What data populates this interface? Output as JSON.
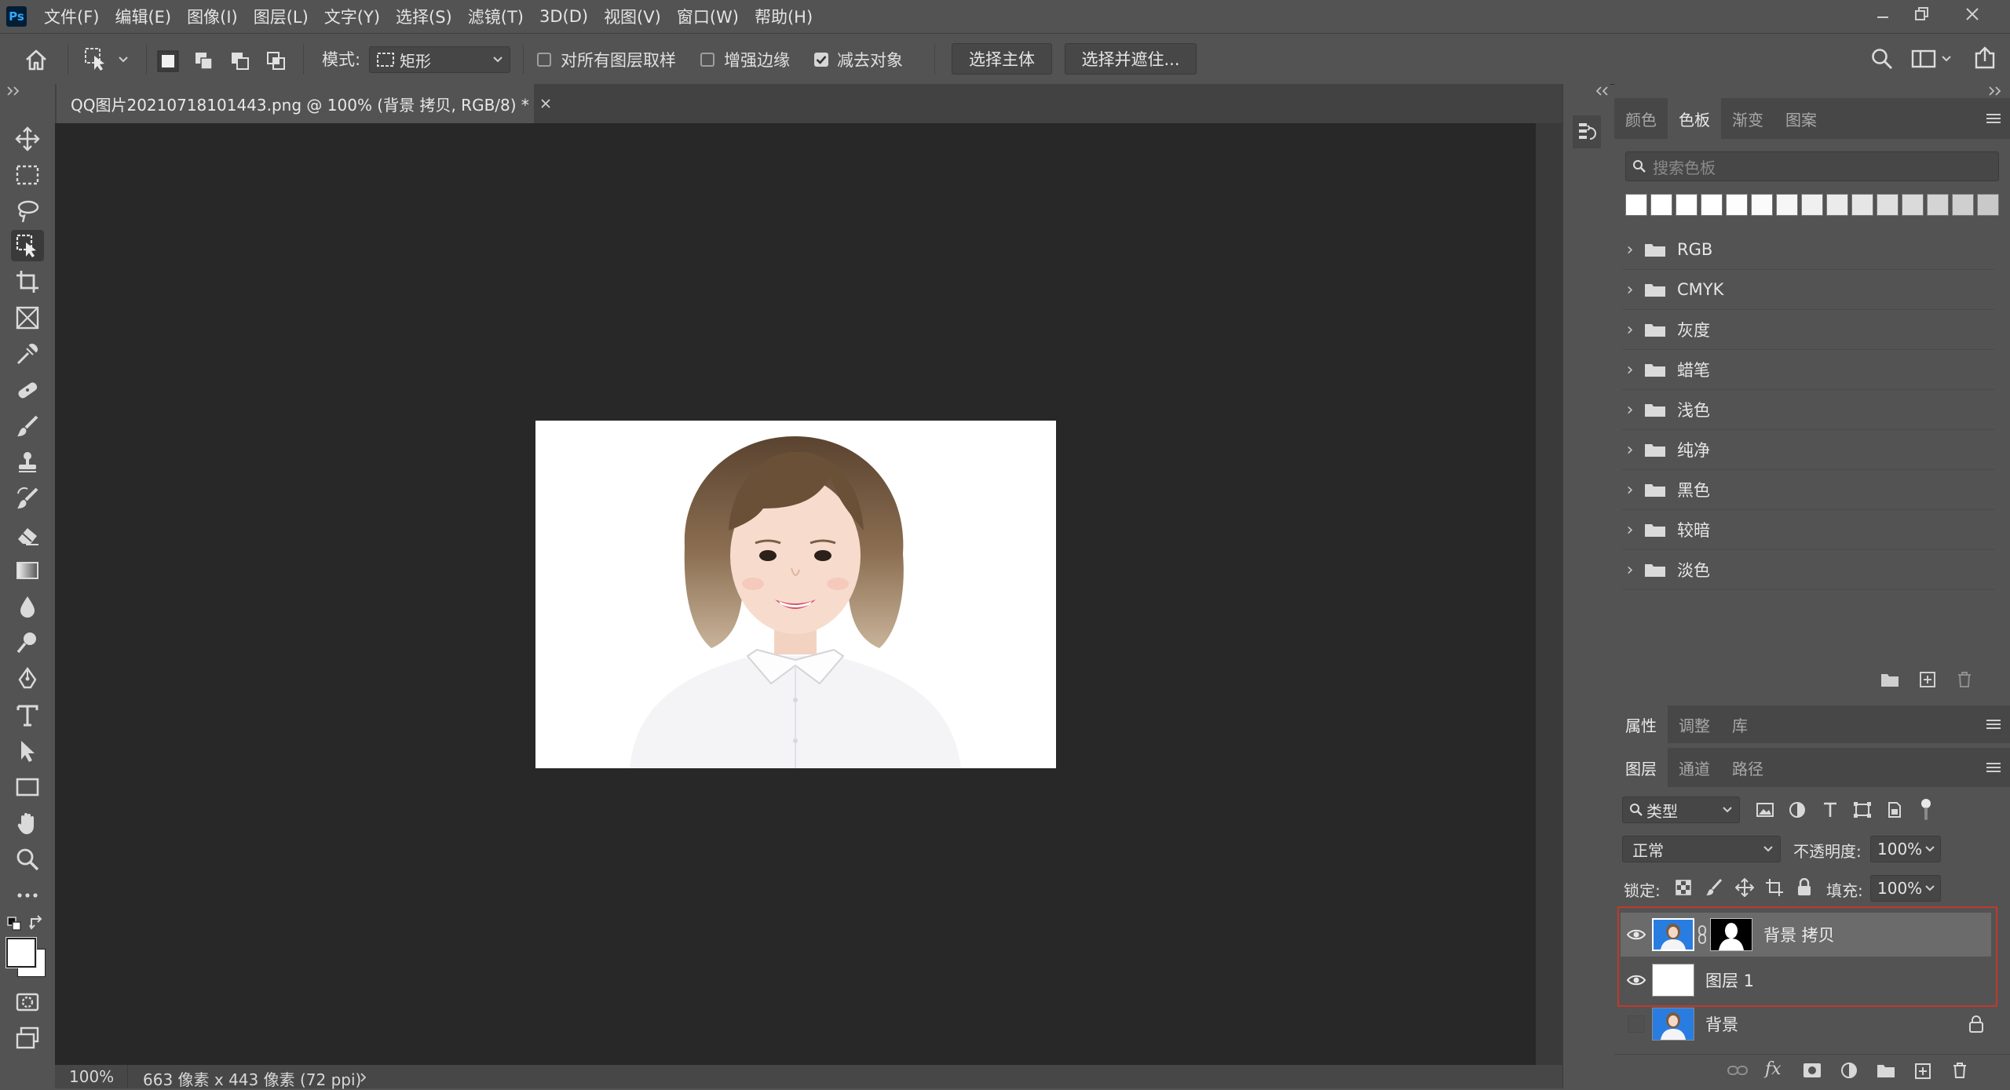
{
  "app": {
    "logo": "Ps"
  },
  "menu": [
    "文件(F)",
    "编辑(E)",
    "图像(I)",
    "图层(L)",
    "文字(Y)",
    "选择(S)",
    "滤镜(T)",
    "3D(D)",
    "视图(V)",
    "窗口(W)",
    "帮助(H)"
  ],
  "options": {
    "mode_label": "模式:",
    "mode_value": "矩形",
    "sample_all": "对所有图层取样",
    "enhance_edge": "增强边缘",
    "subtract_object": "减去对象",
    "select_subject": "选择主体",
    "select_and_mask": "选择并遮住..."
  },
  "document": {
    "tab_title": "QQ图片20210718101443.png @ 100% (背景 拷贝, RGB/8) *",
    "zoom": "100%",
    "info": "663 像素 x 443 像素 (72 ppi)"
  },
  "swatches_panel": {
    "tabs": [
      "颜色",
      "色板",
      "渐变",
      "图案"
    ],
    "active_tab": "色板",
    "search_placeholder": "搜索色板",
    "groups": [
      "RGB",
      "CMYK",
      "灰度",
      "蜡笔",
      "浅色",
      "纯净",
      "黑色",
      "较暗",
      "淡色"
    ]
  },
  "properties_panel": {
    "tabs": [
      "属性",
      "调整",
      "库"
    ],
    "active_tab": "属性"
  },
  "layers_panel": {
    "tabs": [
      "图层",
      "通道",
      "路径"
    ],
    "active_tab": "图层",
    "filter_kind": "类型",
    "blend_mode": "正常",
    "opacity_label": "不透明度:",
    "opacity_value": "100%",
    "lock_label": "锁定:",
    "fill_label": "填充:",
    "fill_value": "100%",
    "layers": [
      {
        "name": "背景 拷贝",
        "visible": true,
        "selected": true
      },
      {
        "name": "图层 1",
        "visible": true,
        "selected": false
      },
      {
        "name": "背景",
        "visible": false,
        "selected": false,
        "locked": true
      }
    ],
    "footer_fx": "fx"
  },
  "colors": {
    "accent": "#1473e6",
    "highlight_red": "#c0392b"
  }
}
